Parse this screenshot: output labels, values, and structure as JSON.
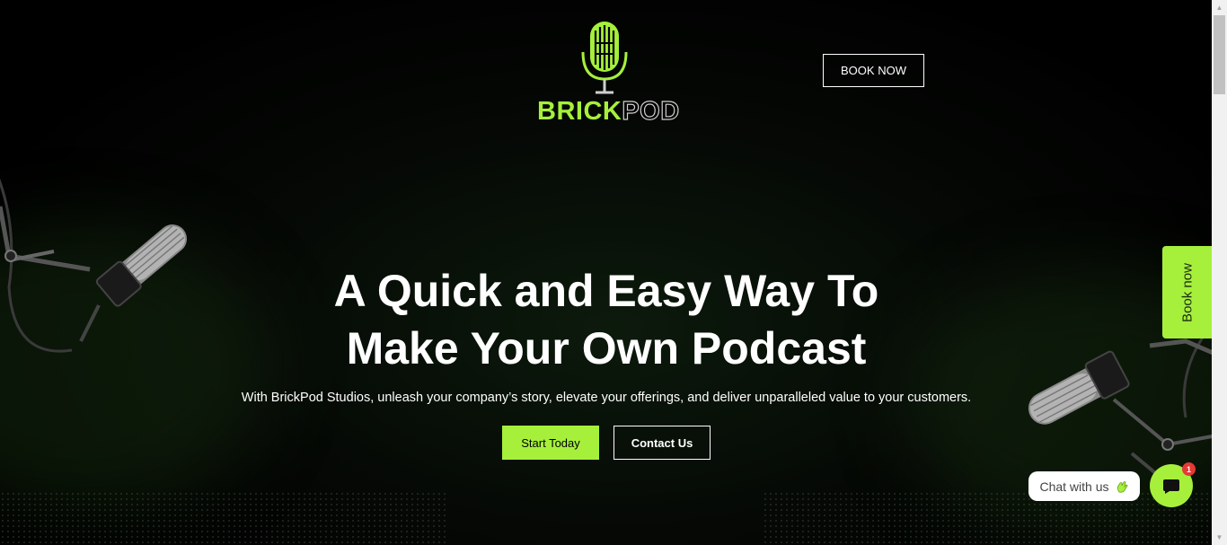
{
  "brand": {
    "name_part1": "BRICK",
    "name_part2": "POD",
    "accent_color": "#a6f03c"
  },
  "header": {
    "book_now_label": "BOOK NOW"
  },
  "hero": {
    "title_line1": "A Quick and Easy Way To",
    "title_line2": "Make Your Own Podcast",
    "subtitle": "With BrickPod Studios, unleash your company’s story, elevate your offerings, and deliver unparalleled value to your customers.",
    "start_label": "Start Today",
    "contact_label": "Contact Us"
  },
  "side_tab": {
    "label": "Book now"
  },
  "chat": {
    "pill_label": "Chat with us",
    "badge_count": "1"
  },
  "icons": [
    "microphone-logo-icon",
    "microphone-image",
    "chat-icon",
    "wave-hand-icon"
  ]
}
